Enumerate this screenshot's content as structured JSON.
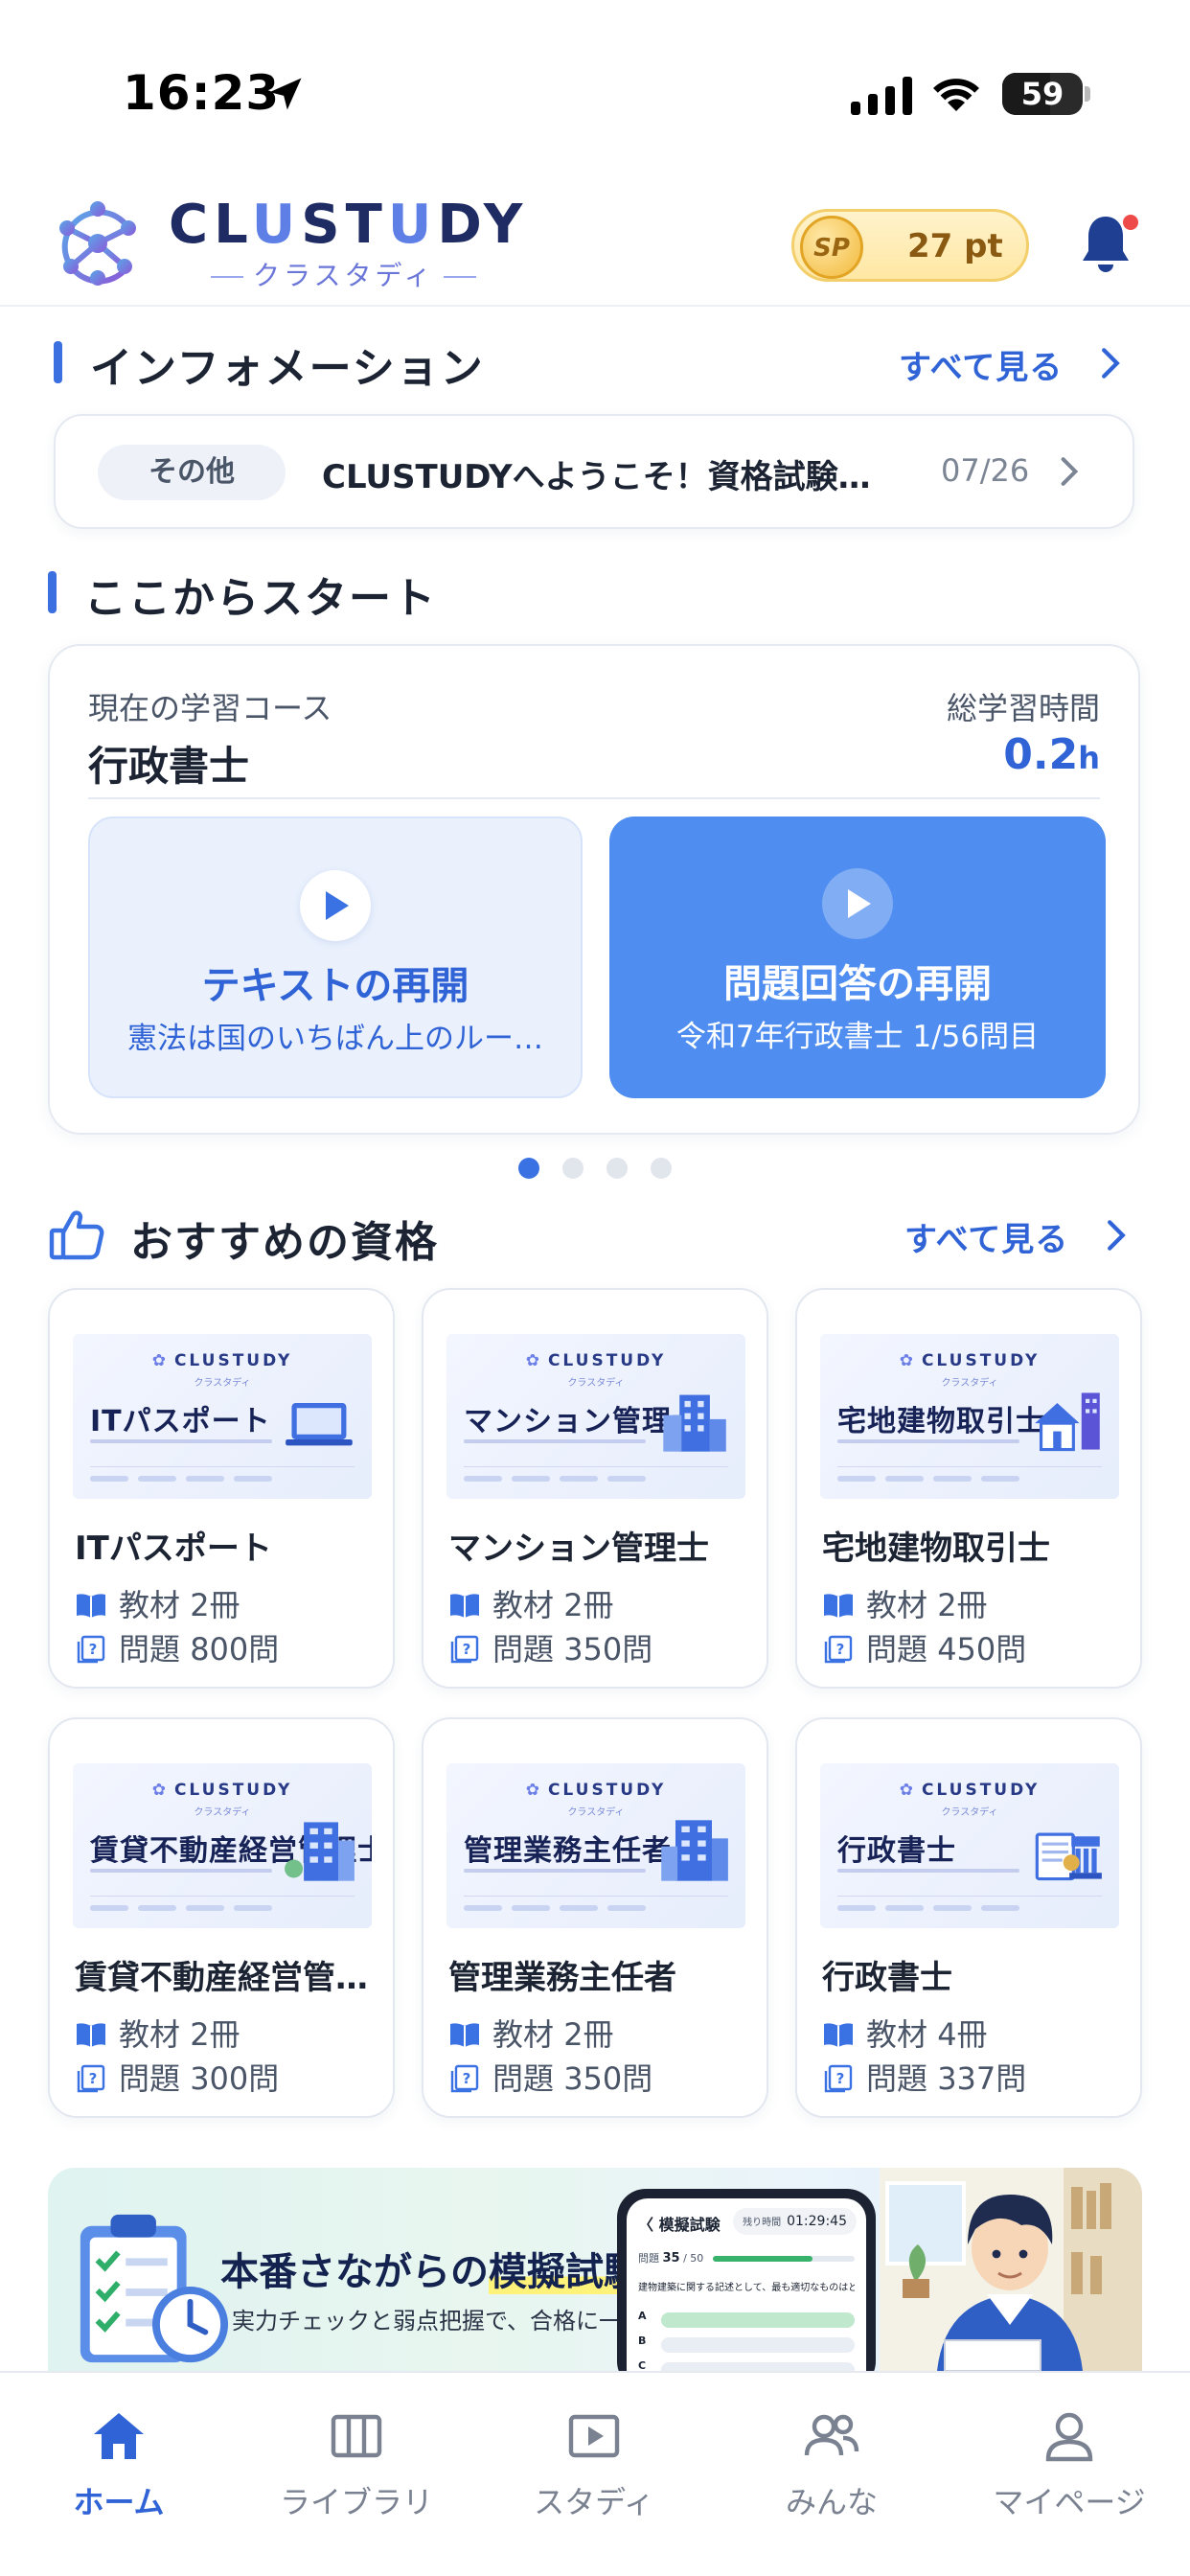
{
  "status_bar": {
    "time": "16:23",
    "battery": "59",
    "battery_level": 0.59
  },
  "header": {
    "logo": "CLUSTUDY",
    "logo_sub": "クラスタディ",
    "points": "27 pt",
    "points_coin": "SP"
  },
  "info": {
    "section_title": "インフォメーション",
    "see_all": "すべて見る",
    "item": {
      "tag": "その他",
      "text": "CLUSTUDYへようこそ！資格試験…",
      "date": "07/26"
    }
  },
  "start": {
    "section_title": "ここからスタート",
    "course_label": "現在の学習コース",
    "course_name": "行政書士",
    "time_label": "総学習時間",
    "time_value": "0.2",
    "time_unit": "h",
    "resume_text": {
      "title": "テキストの再開",
      "subtitle": "憲法は国のいちばん上のルー…"
    },
    "resume_quiz": {
      "title": "問題回答の再開",
      "subtitle": "令和7年行政書士 1/56問目"
    },
    "page_dots": 4,
    "active_dot": 1
  },
  "recommended": {
    "section_title": "おすすめの資格",
    "see_all": "すべて見る",
    "image_brand": "CLUSTUDY",
    "image_brand_sub": "クラスタディ",
    "book_prefix": "教材",
    "quiz_prefix": "問題",
    "items": [
      {
        "name": "ITパスポート",
        "image_title": "ITパスポート",
        "books": "2冊",
        "questions": "800問"
      },
      {
        "name": "マンション管理士",
        "image_title": "マンション管理士",
        "books": "2冊",
        "questions": "350問"
      },
      {
        "name": "宅地建物取引士",
        "image_title": "宅地建物取引士",
        "books": "2冊",
        "questions": "450問"
      },
      {
        "name": "賃貸不動産経営管…",
        "image_title": "賃貸不動産経営管理士",
        "books": "2冊",
        "questions": "300問"
      },
      {
        "name": "管理業務主任者",
        "image_title": "管理業務主任者",
        "books": "2冊",
        "questions": "350問"
      },
      {
        "name": "行政書士",
        "image_title": "行政書士",
        "books": "4冊",
        "questions": "337問"
      }
    ]
  },
  "banner": {
    "title_a": "本番さながらの",
    "title_b": "模擬試験",
    "title_c": "!",
    "subtitle": "実力チェックと弱点把握で、合格に一歩リード",
    "phone_title": "〈 模擬試験",
    "phone_timer_label": "残り時間",
    "phone_timer": "01:29:45",
    "phone_progress_label": "問題",
    "phone_progress_value": "35",
    "phone_progress_total": "/ 50",
    "phone_progress_fraction": 0.7,
    "phone_question": "建物建築に関する記述として、最も適切なものはどれか。",
    "phone_options": [
      "A",
      "B",
      "C"
    ]
  },
  "tabbar": {
    "items": [
      {
        "label": "ホーム",
        "icon": "home-icon",
        "active": true
      },
      {
        "label": "ライブラリ",
        "icon": "library-icon",
        "active": false
      },
      {
        "label": "スタディ",
        "icon": "study-icon",
        "active": false
      },
      {
        "label": "みんな",
        "icon": "people-icon",
        "active": false
      },
      {
        "label": "マイページ",
        "icon": "person-icon",
        "active": false
      }
    ]
  },
  "colors": {
    "accent": "#2f63d6",
    "accent_button": "#4f8ef0",
    "text": "#1c2433",
    "muted": "#7a8291"
  }
}
